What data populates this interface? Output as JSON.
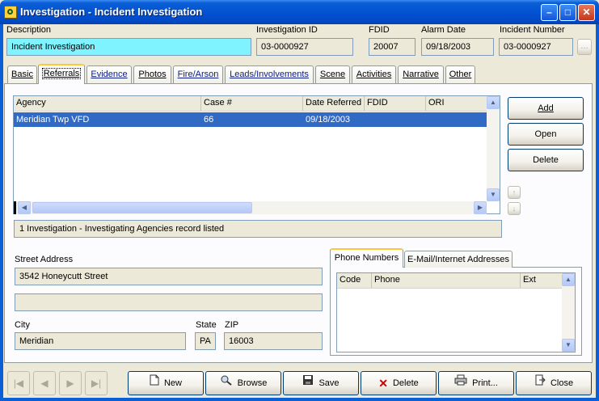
{
  "window": {
    "title": "Investigation - Incident Investigation"
  },
  "header": {
    "description_label": "Description",
    "description_value": "Incident Investigation",
    "investigation_id_label": "Investigation ID",
    "investigation_id_value": "03-0000927",
    "fdid_label": "FDID",
    "fdid_value": "20007",
    "alarm_date_label": "Alarm Date",
    "alarm_date_value": "09/18/2003",
    "incident_number_label": "Incident Number",
    "incident_number_value": "03-0000927",
    "lookup_label": "..."
  },
  "tabs": [
    {
      "label": "Basic"
    },
    {
      "label": "Referrals"
    },
    {
      "label": "Evidence"
    },
    {
      "label": "Photos"
    },
    {
      "label": "Fire/Arson"
    },
    {
      "label": "Leads/Involvements"
    },
    {
      "label": "Scene"
    },
    {
      "label": "Activities"
    },
    {
      "label": "Narrative"
    },
    {
      "label": "Other"
    }
  ],
  "referrals": {
    "columns": [
      "Agency",
      "Case #",
      "Date Referred",
      "FDID",
      "ORI"
    ],
    "rows": [
      {
        "agency": "Meridian Twp VFD",
        "case": "66",
        "date": "09/18/2003",
        "fdid": "",
        "ori": ""
      }
    ],
    "status": "1 Investigation - Investigating Agencies record listed",
    "buttons": {
      "add": "Add",
      "open": "Open",
      "delete": "Delete"
    }
  },
  "address": {
    "street_label": "Street Address",
    "street_value": "3542 Honeycutt Street",
    "street2_value": "",
    "city_label": "City",
    "city_value": "Meridian",
    "state_label": "State",
    "state_value": "PA",
    "zip_label": "ZIP",
    "zip_value": "16003"
  },
  "contact_tabs": [
    {
      "label": "Phone Numbers"
    },
    {
      "label": "E-Mail/Internet Addresses"
    }
  ],
  "phone": {
    "columns": [
      "Code",
      "Phone",
      "Ext"
    ]
  },
  "bottom_buttons": {
    "new": "New",
    "browse": "Browse",
    "save": "Save",
    "delete": "Delete",
    "print": "Print...",
    "close": "Close"
  },
  "colors": {
    "selection": "#316ac5",
    "description_field": "#7ff3ff",
    "active_tab_accent": "#ffc83c"
  }
}
